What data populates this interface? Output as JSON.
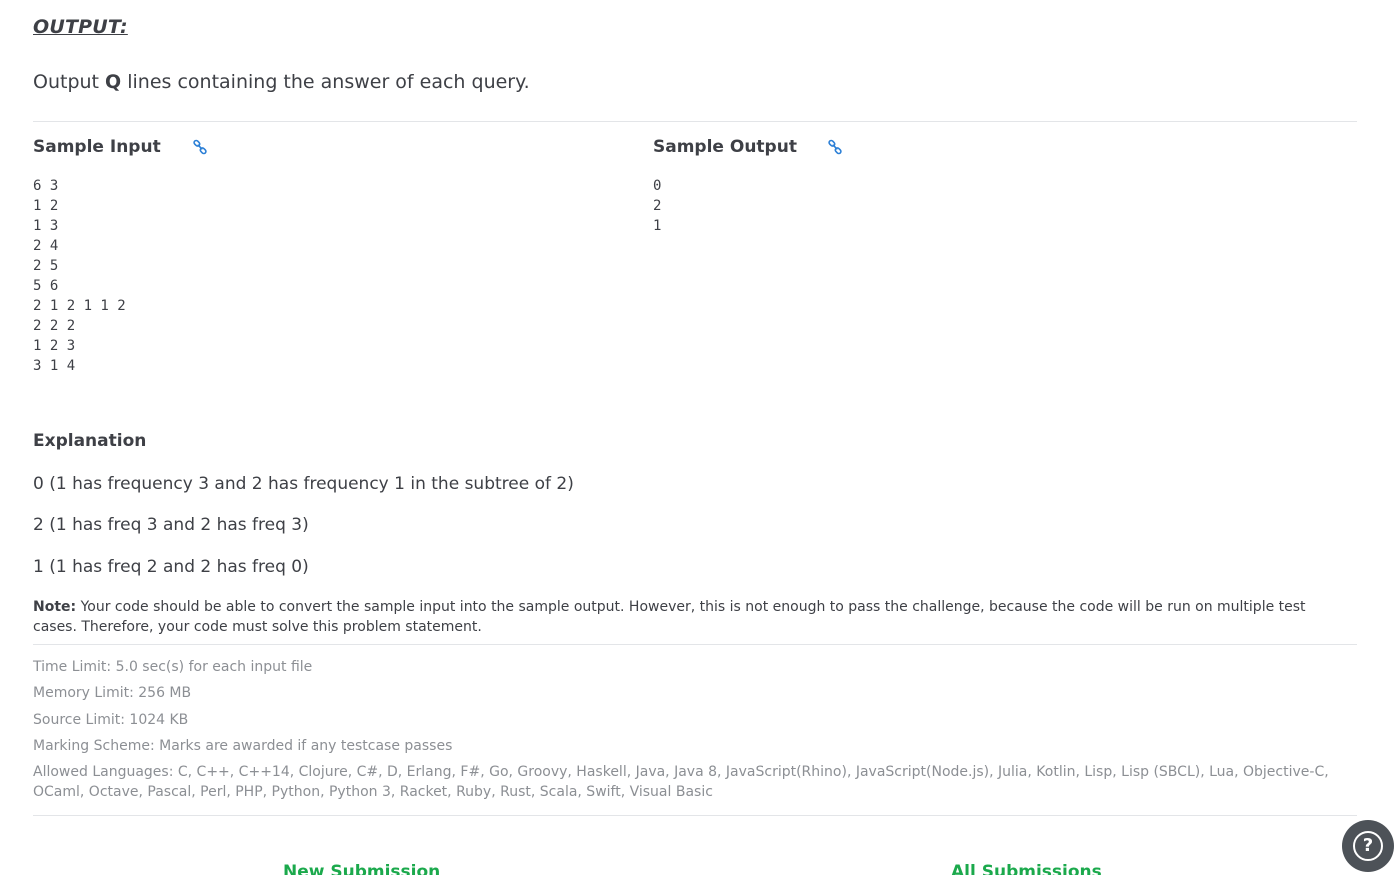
{
  "output_section": {
    "heading": "OUTPUT:",
    "desc_prefix": "Output ",
    "desc_bold": "Q",
    "desc_suffix": " lines containing the answer of each query."
  },
  "sample_input": {
    "title": "Sample Input",
    "icon": "link-icon",
    "lines": [
      "6 3",
      "1 2",
      "1 3",
      "2 4",
      "2 5",
      "5 6",
      "2 1 2 1 1 2",
      "2 2 2",
      "1 2 3",
      "3 1 4"
    ]
  },
  "sample_output": {
    "title": "Sample Output",
    "icon": "link-icon",
    "lines": [
      "0",
      "2",
      "1"
    ]
  },
  "explanation": {
    "title": "Explanation",
    "lines": [
      "0 (1 has frequency 3 and 2 has frequency 1 in the subtree of 2)",
      "2 (1 has freq 3 and 2 has freq 3)",
      "1 (1 has freq 2 and 2 has freq 0)"
    ]
  },
  "note": {
    "label": "Note:",
    "text": " Your code should be able to convert the sample input into the sample output. However, this is not enough to pass the challenge, because the code will be run on multiple test cases. Therefore, your code must solve this problem statement."
  },
  "limits": {
    "time": "Time Limit: 5.0 sec(s) for each input file",
    "memory": "Memory Limit: 256 MB",
    "source": "Source Limit: 1024 KB",
    "marking": "Marking Scheme: Marks are awarded if any testcase passes",
    "languages": "Allowed Languages: C, C++, C++14, Clojure, C#, D, Erlang, F#, Go, Groovy, Haskell, Java, Java 8, JavaScript(Rhino), JavaScript(Node.js), Julia, Kotlin, Lisp, Lisp (SBCL), Lua, Objective-C, OCaml, Octave, Pascal, Perl, PHP, Python, Python 3, Racket, Ruby, Rust, Scala, Swift, Visual Basic"
  },
  "nav": {
    "new_submission": "New Submission",
    "all_submissions": "All Submissions"
  },
  "help": {
    "icon": "help-icon",
    "glyph": "?"
  },
  "colors": {
    "text": "#3e4046",
    "muted": "#8c8f94",
    "link": "#2b7fd6",
    "accent": "#1ba94c",
    "divider": "#e3e5e8",
    "help_bg": "#4d5258"
  }
}
